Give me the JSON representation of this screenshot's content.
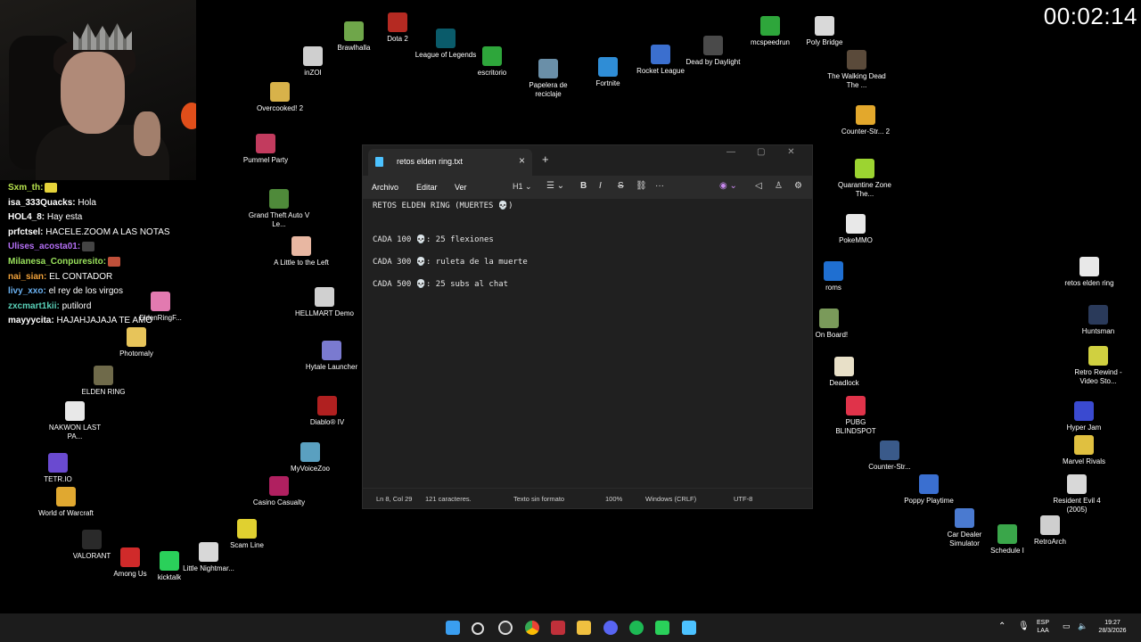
{
  "timer": "00:02:14",
  "chat": [
    {
      "user": "Sxm_th:",
      "user_color": "#b7e34e",
      "text": "",
      "emote_color": "#e5d33a"
    },
    {
      "user": "isa_333Quacks:",
      "user_color": "#ffffff",
      "text": " Hola",
      "emote_color": ""
    },
    {
      "user": "HOL4_8:",
      "user_color": "#ffffff",
      "text": " Hay esta",
      "emote_color": ""
    },
    {
      "user": "prfctsel:",
      "user_color": "#ffffff",
      "text": " HACELE.ZOOM A LAS NOTAS",
      "emote_color": ""
    },
    {
      "user": "Ulises_acosta01:",
      "user_color": "#b46ff5",
      "text": "",
      "emote_color": "#444444"
    },
    {
      "user": "Milanesa_Conpuresito:",
      "user_color": "#9ae25c",
      "text": "",
      "emote_color": "#c0503a"
    },
    {
      "user": "nai_sian:",
      "user_color": "#f0a13a",
      "text": " EL CONTADOR",
      "emote_color": ""
    },
    {
      "user": "livy_xxo:",
      "user_color": "#6ab0f0",
      "text": " el rey de los virgos",
      "emote_color": ""
    },
    {
      "user": "zxcmart1kii:",
      "user_color": "#59d0b8",
      "text": " putilord",
      "emote_color": ""
    },
    {
      "user": "mayyycita:",
      "user_color": "#ffffff",
      "text": " HAJAHJAJAJA TE AMO",
      "emote_color": ""
    }
  ],
  "desktop_icons": [
    {
      "label": "Brawlhalla",
      "color": "#6fa64a"
    },
    {
      "label": "Dota 2",
      "color": "#b52a22"
    },
    {
      "label": "League of Legends",
      "color": "#0a5b6a"
    },
    {
      "label": "escritorio",
      "color": "#2ea63b"
    },
    {
      "label": "Papelera de reciclaje",
      "color": "#6a8fa8"
    },
    {
      "label": "Fortnite",
      "color": "#2f8dd6"
    },
    {
      "label": "Rocket League",
      "color": "#3b6fcf"
    },
    {
      "label": "Dead by Daylight",
      "color": "#4a4a4a"
    },
    {
      "label": "mcspeedrun",
      "color": "#2ea63b"
    },
    {
      "label": "Poly Bridge",
      "color": "#d9d9d9"
    },
    {
      "label": "inZOI",
      "color": "#cfcfcf"
    },
    {
      "label": "Overcooked! 2",
      "color": "#d8b24a"
    },
    {
      "label": "The Walking Dead The ...",
      "color": "#5a4a3a"
    },
    {
      "label": "Counter-Str... 2",
      "color": "#e3a82c"
    },
    {
      "label": "Pummel Party",
      "color": "#c23b5e"
    },
    {
      "label": "Quarantine Zone The...",
      "color": "#9cd431"
    },
    {
      "label": "Grand Theft Auto V Le...",
      "color": "#4f8a3a"
    },
    {
      "label": "PokeMMO",
      "color": "#e8e8e8"
    },
    {
      "label": "A Little to the Left",
      "color": "#e8b7a2"
    },
    {
      "label": "HELLMART Demo",
      "color": "#d0d0d0"
    },
    {
      "label": "roms",
      "color": "#1f6fd1"
    },
    {
      "label": "EldenRingF...",
      "color": "#e27ab0"
    },
    {
      "label": "Photomaly",
      "color": "#e7c45a"
    },
    {
      "label": "ll On Board!",
      "color": "#7a9a5a"
    },
    {
      "label": "Hytale Launcher",
      "color": "#7a7ad0"
    },
    {
      "label": "Deadlock",
      "color": "#e8e0c8"
    },
    {
      "label": "ELDEN RING",
      "color": "#6f6a4a"
    },
    {
      "label": "PUBG BLINDSPOT",
      "color": "#e0334a"
    },
    {
      "label": "NAKWON LAST PA...",
      "color": "#e8e8e8"
    },
    {
      "label": "Diablo® IV",
      "color": "#b02020"
    },
    {
      "label": "Counter-Str...",
      "color": "#3a5a8a"
    },
    {
      "label": "TETR.IO",
      "color": "#6a4ad0"
    },
    {
      "label": "MyVoiceZoo",
      "color": "#5aa0c0"
    },
    {
      "label": "Poppy Playtime",
      "color": "#3a6fd0"
    },
    {
      "label": "World of Warcraft",
      "color": "#e0a830"
    },
    {
      "label": "Casino Casualty",
      "color": "#b02060"
    },
    {
      "label": "Car Dealer Simulator",
      "color": "#4a7ad0"
    },
    {
      "label": "Schedule I",
      "color": "#3aa64a"
    },
    {
      "label": "VALORANT",
      "color": "#2a2a2a"
    },
    {
      "label": "Scam Line",
      "color": "#e0d030"
    },
    {
      "label": "Among Us",
      "color": "#d02a2a"
    },
    {
      "label": "kicktalk",
      "color": "#2ad05a"
    },
    {
      "label": "Little Nightmar...",
      "color": "#d8d8d8"
    },
    {
      "label": "retos elden ring",
      "color": "#e8e8e8"
    },
    {
      "label": "Huntsman",
      "color": "#2a3a5a"
    },
    {
      "label": "Retro Rewind - Video Sto...",
      "color": "#d0d040"
    },
    {
      "label": "Hyper Jam",
      "color": "#3a4ad0"
    },
    {
      "label": "Marvel Rivals",
      "color": "#e0c040"
    },
    {
      "label": "Resident Evil 4 (2005)",
      "color": "#d8d8d8"
    },
    {
      "label": "RetroArch",
      "color": "#cfcfcf"
    }
  ],
  "notepad": {
    "tab_title": "retos elden ring.txt",
    "menus": [
      "Archivo",
      "Editar",
      "Ver"
    ],
    "heading_tool": "H1",
    "lines": [
      "RETOS ELDEN RING (MUERTES 💀)",
      "",
      "",
      "CADA 100 💀: 25 flexiones",
      "",
      "CADA 300 💀: ruleta de la muerte",
      "",
      "CADA 500 💀: 25 subs al chat"
    ],
    "status": {
      "position": "Ln 8, Col 29",
      "chars": "121 caracteres.",
      "format": "Texto sin formato",
      "zoom": "100%",
      "eol": "Windows (CRLF)",
      "encoding": "UTF-8"
    }
  },
  "taskbar": {
    "lang_top": "ESP",
    "lang_bottom": "LAA",
    "time": "19:27",
    "date": "28/3/2026"
  }
}
